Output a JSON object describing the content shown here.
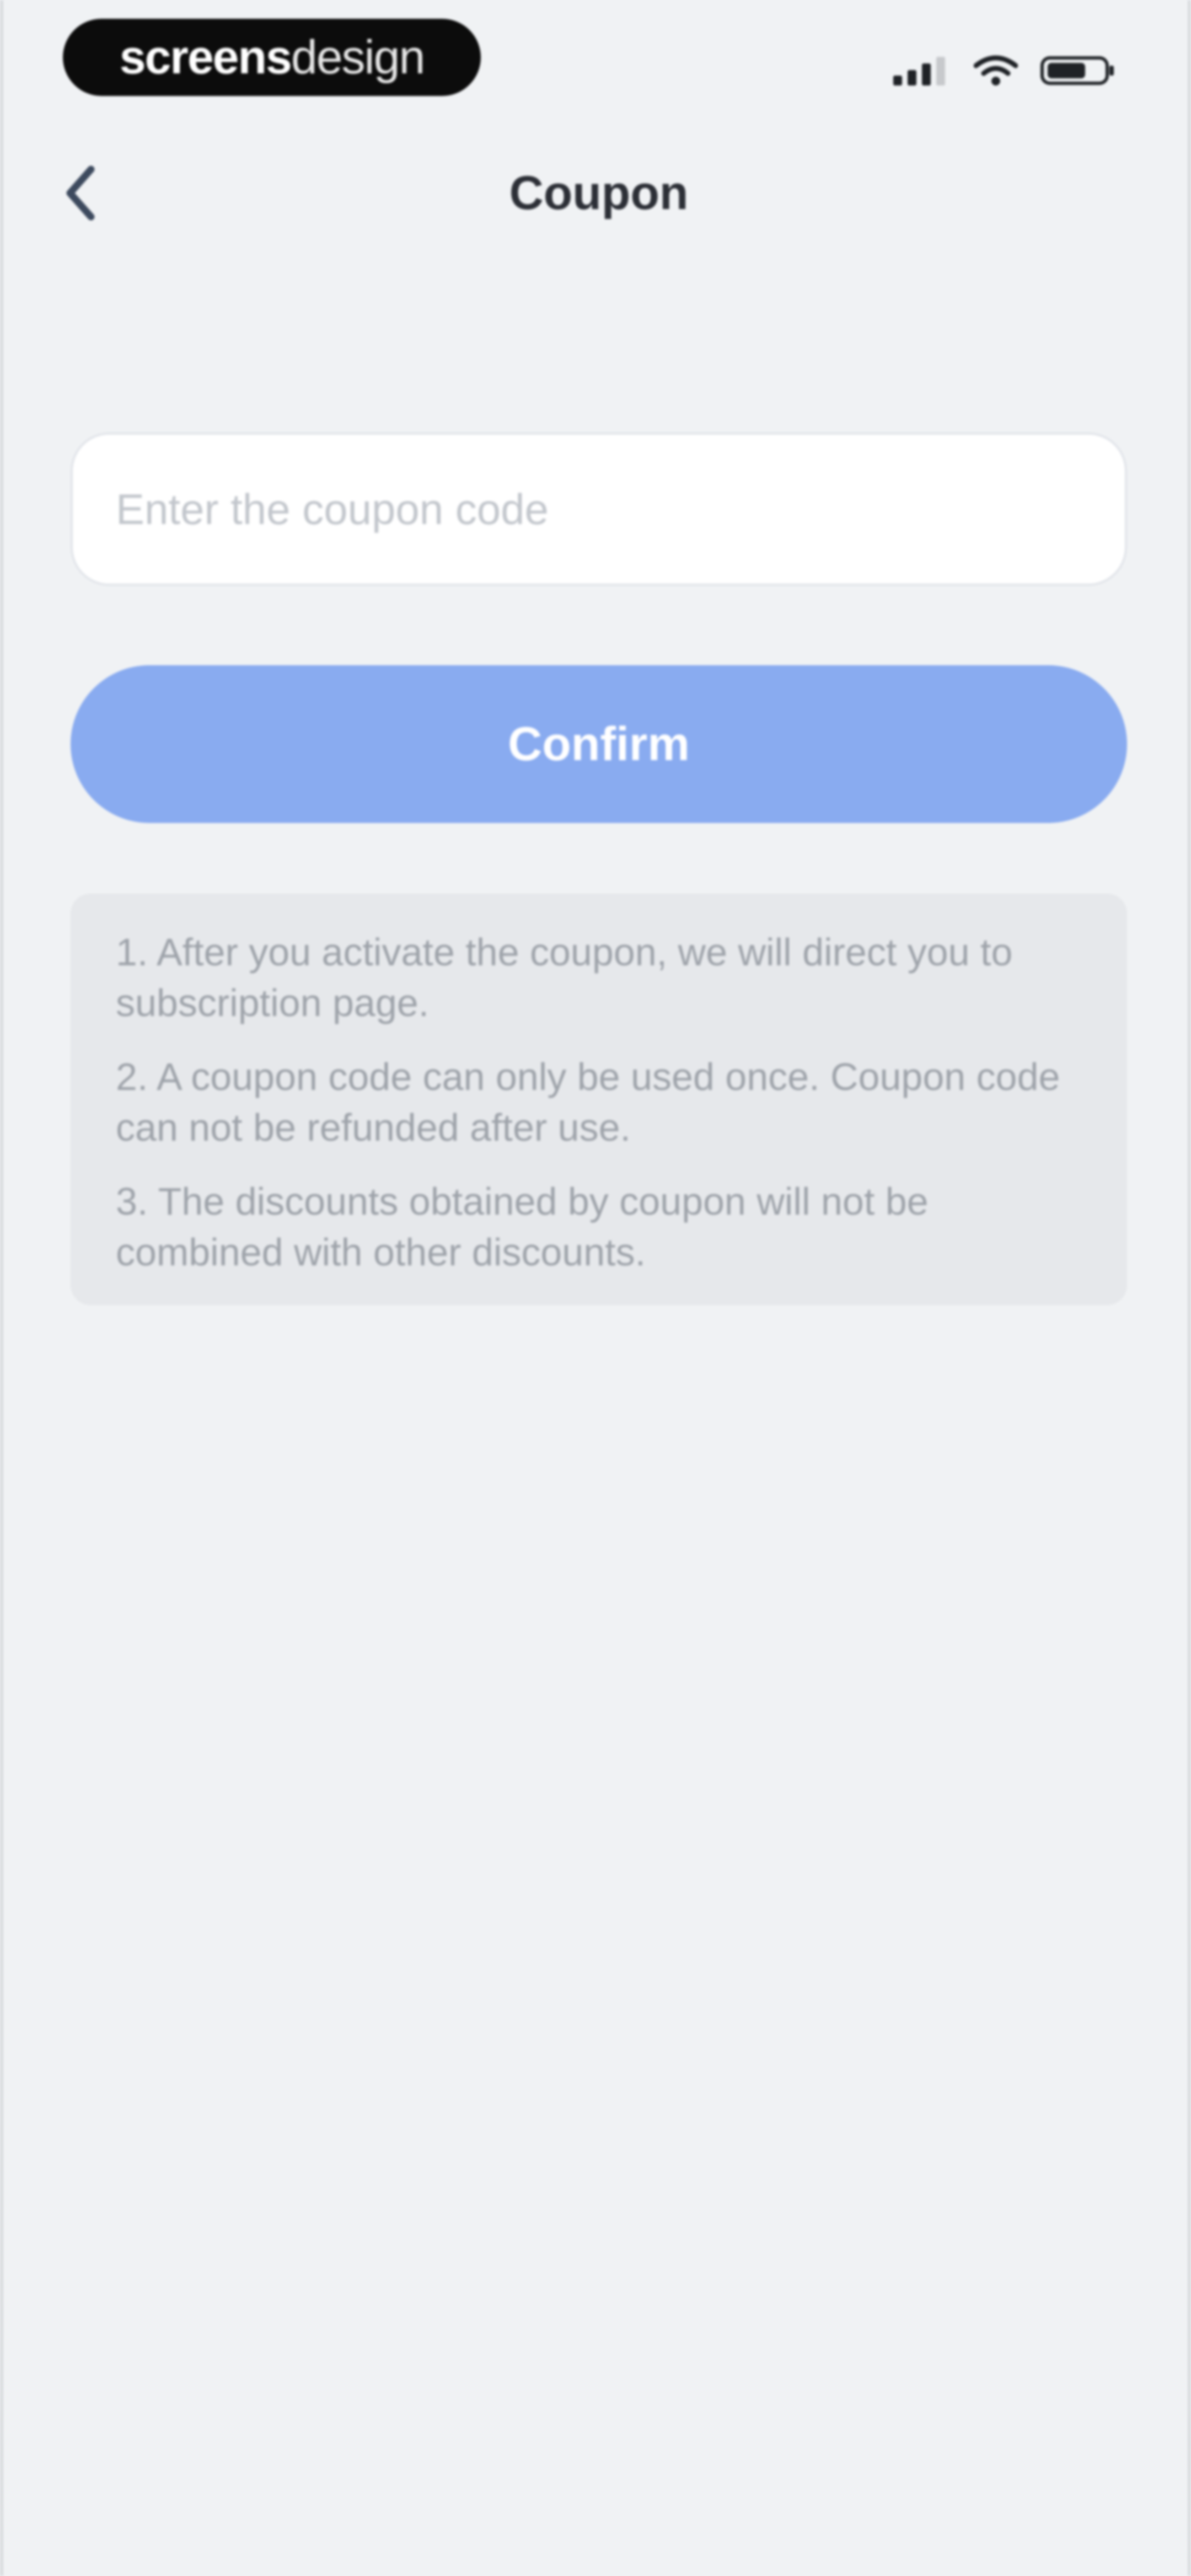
{
  "status_bar": {
    "brand_strong": "screens",
    "brand_light": "design",
    "icons": [
      "signal-icon",
      "wifi-icon",
      "battery-icon"
    ]
  },
  "nav": {
    "title": "Coupon",
    "back_icon": "chevron-left-icon"
  },
  "coupon_input": {
    "value": "",
    "placeholder": "Enter the coupon code"
  },
  "confirm": {
    "label": "Confirm",
    "color": "#89abf0"
  },
  "notes": [
    {
      "text": "1. After you activate the coupon, we will direct you to subscription page."
    },
    {
      "text": "2. A coupon code can only be used once. Coupon code can not be refunded after use."
    },
    {
      "text": "3. The discounts obtained by coupon will not be combined with other discounts."
    }
  ],
  "colors": {
    "background": "#f0f2f4",
    "title": "#2c2f36",
    "note_text": "#9ea3aa",
    "notes_card": "#e6e8eb"
  }
}
